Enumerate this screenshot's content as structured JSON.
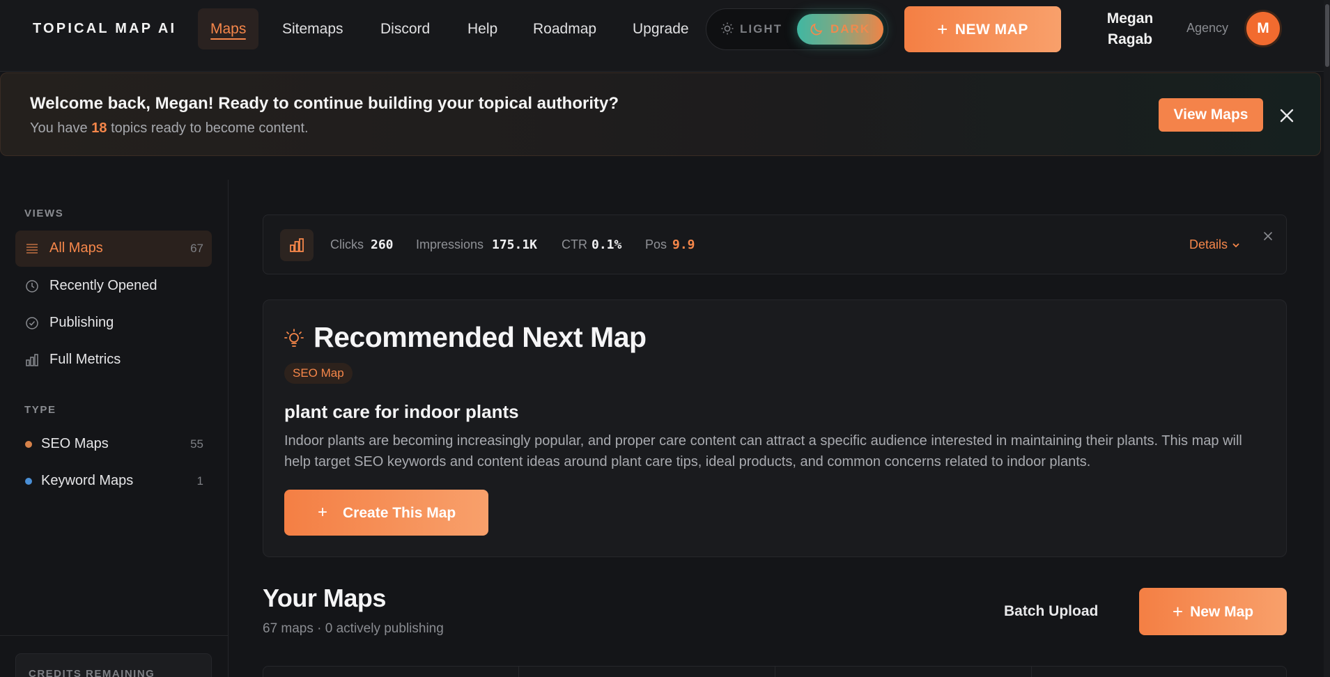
{
  "brand": "TOPICAL MAP AI",
  "nav": {
    "items": [
      {
        "label": "Maps",
        "active": true
      },
      {
        "label": "Sitemaps"
      },
      {
        "label": "Discord"
      },
      {
        "label": "Help"
      },
      {
        "label": "Roadmap"
      },
      {
        "label": "Upgrade"
      }
    ]
  },
  "theme": {
    "light_label": "LIGHT",
    "dark_label": "DARK",
    "selected": "dark"
  },
  "header": {
    "new_map_label": "NEW MAP",
    "user_first": "Megan",
    "user_last": "Ragab",
    "plan": "Agency",
    "avatar_initial": "M"
  },
  "welcome": {
    "title": "Welcome back, Megan! Ready to continue building your topical authority?",
    "sub_prefix": "You have",
    "topics_count": "18",
    "sub_suffix": "topics ready to become content.",
    "view_maps_label": "View Maps"
  },
  "sidebar": {
    "views_heading": "VIEWS",
    "views": [
      {
        "label": "All Maps",
        "count": "67",
        "icon": "list-icon",
        "active": true
      },
      {
        "label": "Recently Opened",
        "icon": "clock-icon"
      },
      {
        "label": "Publishing",
        "icon": "check-circle-icon"
      },
      {
        "label": "Full Metrics",
        "icon": "bar-chart-icon"
      }
    ],
    "type_heading": "TYPE",
    "types": [
      {
        "label": "SEO Maps",
        "count": "55",
        "dot_color": "#d6824a"
      },
      {
        "label": "Keyword Maps",
        "count": "1",
        "dot_color": "#4a8fd6"
      }
    ],
    "credits_label": "CREDITS REMAINING"
  },
  "metrics": {
    "clicks_label": "Clicks",
    "clicks_value": "260",
    "impressions_label": "Impressions",
    "impressions_value": "175.1K",
    "ctr_label": "CTR",
    "ctr_value": "0.1%",
    "pos_label": "Pos",
    "pos_value": "9.9",
    "details_label": "Details"
  },
  "recommendation": {
    "title": "Recommended Next Map",
    "tag": "SEO Map",
    "topic": "plant care for indoor plants",
    "description": "Indoor plants are becoming increasingly popular, and proper care content can attract a specific audience interested in maintaining their plants. This map will help target SEO keywords and content ideas around plant care tips, ideal products, and common concerns related to indoor plants.",
    "create_label": "Create This Map"
  },
  "your_maps": {
    "title": "Your Maps",
    "subtitle": "67 maps · 0 actively publishing",
    "batch_upload_label": "Batch Upload",
    "new_map_label": "New Map"
  },
  "colors": {
    "accent": "#f6874a",
    "background": "#141518",
    "card": "#1a1b1e"
  }
}
